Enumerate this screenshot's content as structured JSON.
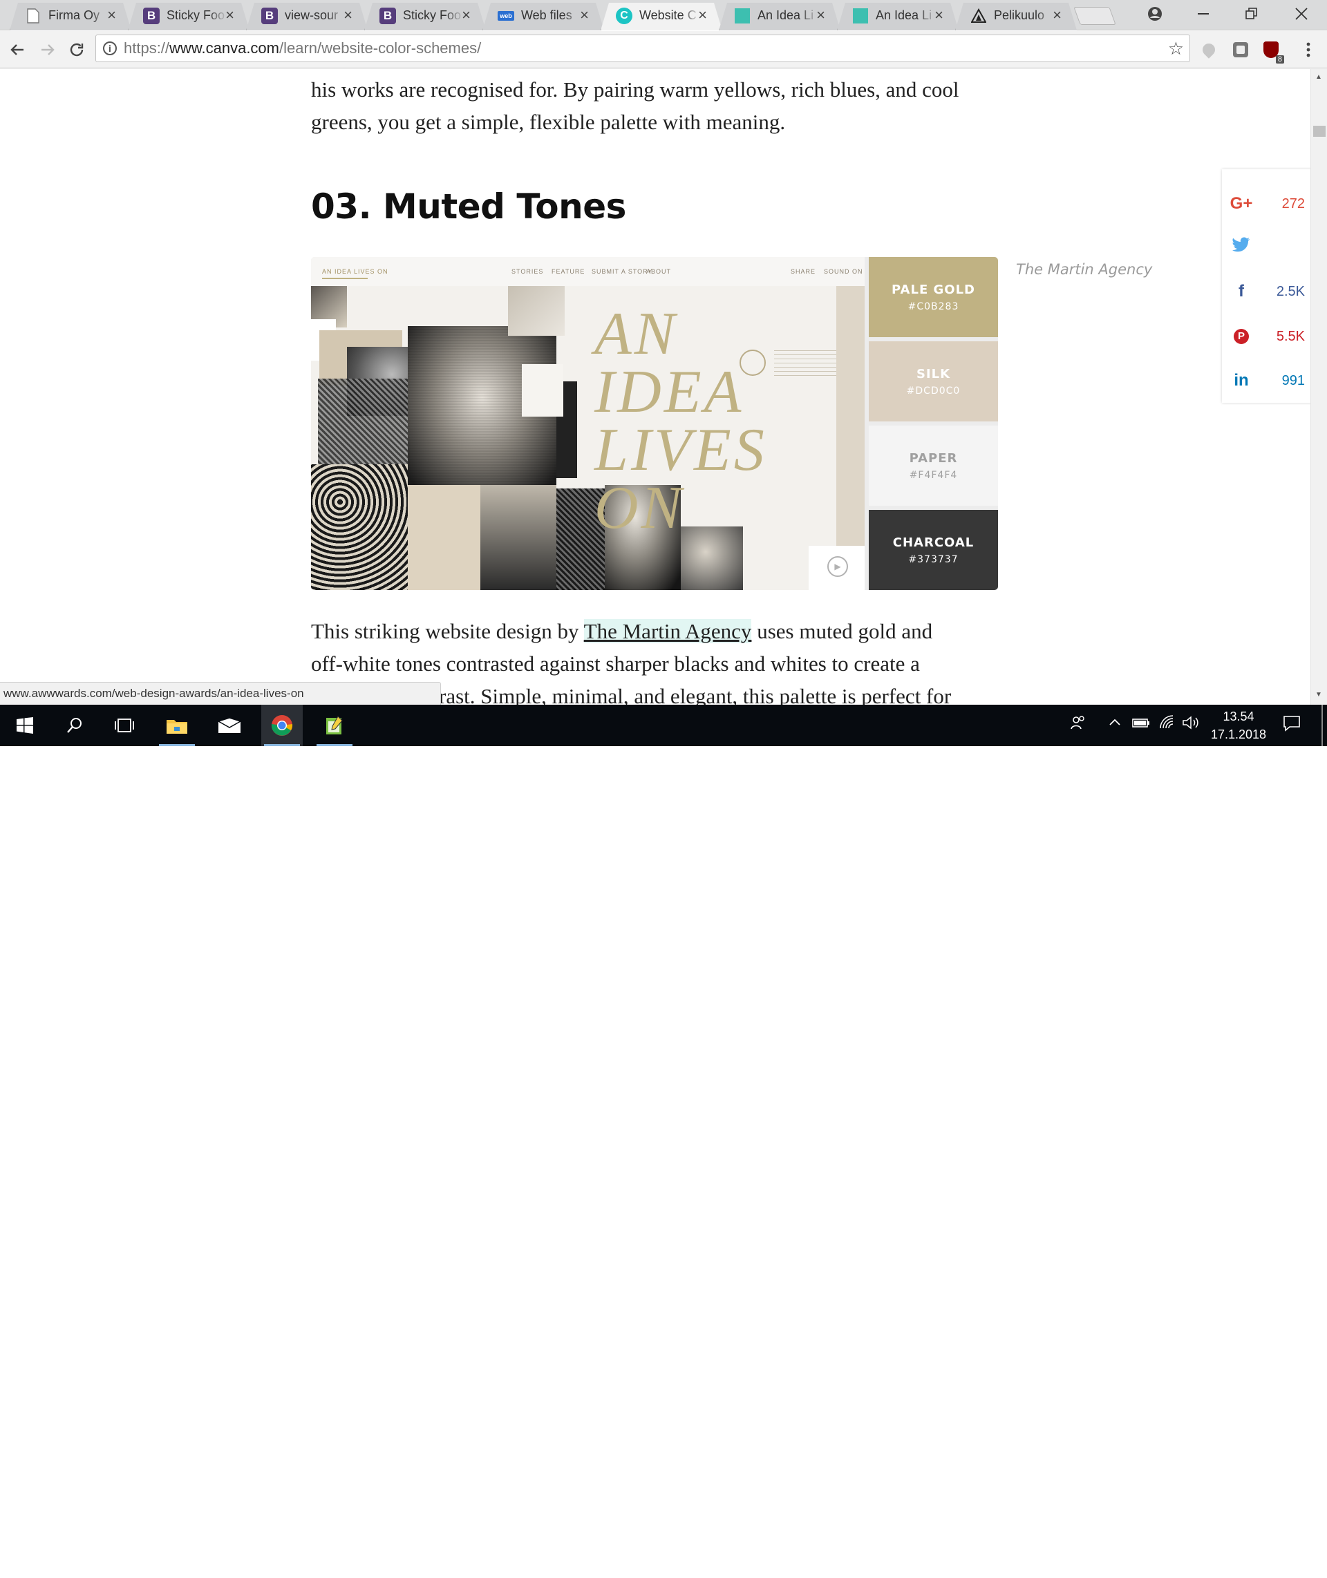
{
  "browser": {
    "tabs": [
      {
        "title": "Firma Oy",
        "icon": "document-icon",
        "active": false
      },
      {
        "title": "Sticky Foo",
        "icon": "bootstrap-icon",
        "active": false
      },
      {
        "title": "view-sour",
        "icon": "bootstrap-icon",
        "active": false
      },
      {
        "title": "Sticky Foo",
        "icon": "bootstrap-icon",
        "active": false
      },
      {
        "title": "Web files",
        "icon": "webfiles-icon",
        "active": false
      },
      {
        "title": "Website C",
        "icon": "canva-icon",
        "active": true
      },
      {
        "title": "An Idea Li",
        "icon": "teal-square-icon",
        "active": false
      },
      {
        "title": "An Idea Li",
        "icon": "teal-square-icon",
        "active": false
      },
      {
        "title": "Pelikuulo",
        "icon": "triangle-logo-icon",
        "active": false
      }
    ],
    "tab_close_glyph": "×",
    "url_scheme": "https://",
    "url_host": "www.canva.com",
    "url_path": "/learn/website-color-schemes/",
    "status_url": "www.awwwards.com/web-design-awards/an-idea-lives-on",
    "extension_badge": "8"
  },
  "article": {
    "para_top_line1": "his works are recognised for. By pairing warm yellows, rich blues, and cool",
    "para_top_line2": "greens, you get a simple, flexible palette with meaning.",
    "heading": "03. Muted Tones",
    "caption": "The Martin Agency",
    "hero": {
      "site_nav": [
        "STORIES",
        "FEATURE",
        "SUBMIT A STORY",
        "ABOUT"
      ],
      "site_nav_right": [
        "SHARE",
        "SOUND ON"
      ],
      "brand": "AN IDEA LIVES ON",
      "headline_lines": [
        "AN",
        "IDEA",
        "LIVES",
        "ON"
      ],
      "swatches": [
        {
          "name": "PALE GOLD",
          "hex": "#C0B283",
          "color": "#C0B283",
          "text_color": "#ffffff"
        },
        {
          "name": "SILK",
          "hex": "#DCD0C0",
          "color": "#DCD0C0",
          "text_color": "#ffffff"
        },
        {
          "name": "PAPER",
          "hex": "#F4F4F4",
          "color": "#F4F4F4",
          "text_color": "#a0a0a0"
        },
        {
          "name": "CHARCOAL",
          "hex": "#373737",
          "color": "#373737",
          "text_color": "#ffffff"
        }
      ]
    },
    "para2_before_link": "This striking website design by ",
    "para2_link": "The Martin Agency",
    "para2_after_link": " uses muted gold and",
    "para2_line2": "off-white tones contrasted against sharper blacks and whites to create a",
    "para2_line3": "rast. Simple, minimal, and elegant, this palette is perfect for"
  },
  "share": [
    {
      "network": "google-plus",
      "icon_text": "G+",
      "count": "272",
      "color": "#dd4b39"
    },
    {
      "network": "twitter",
      "icon_text": "🐦",
      "count": "",
      "color": "#55acee"
    },
    {
      "network": "facebook",
      "icon_text": "f",
      "count": "2.5K",
      "color": "#3b5998"
    },
    {
      "network": "pinterest",
      "icon_text": "P",
      "count": "5.5K",
      "color": "#cb2027"
    },
    {
      "network": "linkedin",
      "icon_text": "in",
      "count": "991",
      "color": "#0077b5"
    }
  ],
  "taskbar": {
    "time": "13.54",
    "date": "17.1.2018"
  }
}
